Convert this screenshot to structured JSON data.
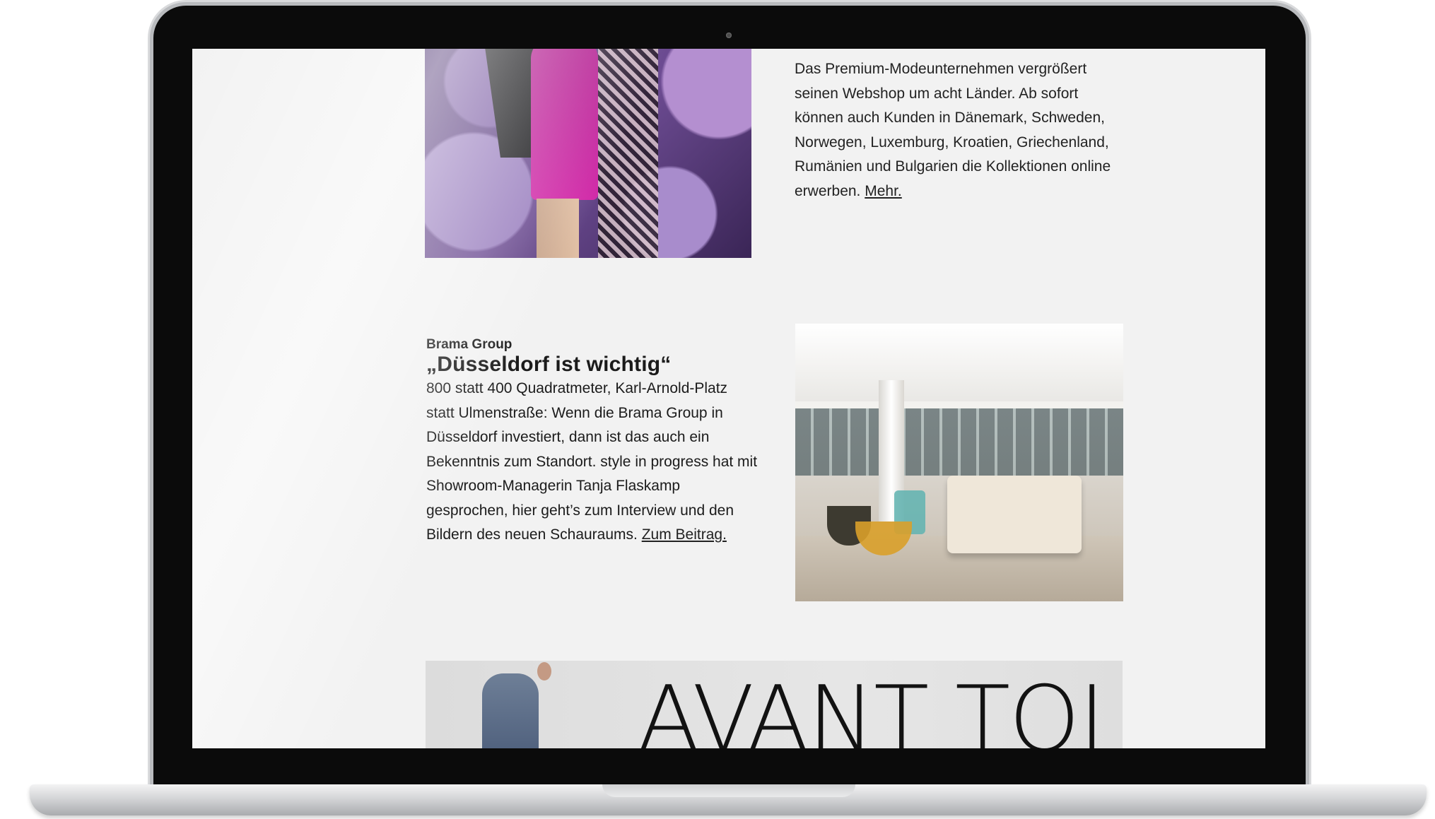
{
  "article_1": {
    "body": "Das Premium-Modeunternehmen vergrößert seinen Webshop um acht Länder. Ab sofort können auch Kunden in Dänemark, Schweden, Norwegen, Luxemburg, Kroatien, Griechenland, Rumänien und Bulgarien die Kollektionen online erwerben.",
    "link": "Mehr."
  },
  "article_2": {
    "kicker": "Brama Group",
    "headline": "„Düsseldorf ist wichtig“",
    "body": "800 statt 400 Quadratmeter, Karl-Arnold-Platz statt Ulmenstraße: Wenn die Brama Group in Düsseldorf investiert, dann ist das auch ein Bekenntnis zum Standort. style in progress hat mit Showroom-Managerin Tanja Flaskamp gesprochen, hier geht’s zum Interview und den Bildern des neuen Schauraums.",
    "link": "Zum Beitrag."
  },
  "banner": {
    "title": "AVANT TOI"
  }
}
